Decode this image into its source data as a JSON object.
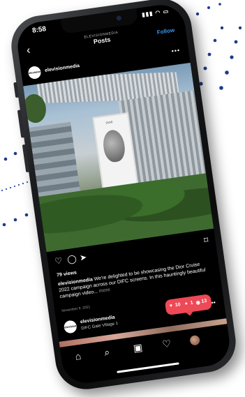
{
  "status_bar": {
    "time": "8:58",
    "icons": "▮▮▮ ◠ ▭"
  },
  "nav": {
    "back_icon": "‹",
    "subtitle": "ELEVISIONMEDIA",
    "title": "Posts",
    "follow_label": "Follow"
  },
  "post": {
    "avatar_text": "elevision",
    "username": "elevisionmedia",
    "more_icon": "•••",
    "views": "79 views",
    "caption_user": "elevisionmedia",
    "caption_text": " We're delighted to be showcasing the Dior Cruise 2022 campaign across our DIFC screens. In this hauntingly beautiful campaign video...",
    "caption_more": " more",
    "date": "November 9, 2021",
    "panel_logo": "DIOR"
  },
  "post2": {
    "username": "elevisionmedia",
    "location": "DIFC Gate Village 1",
    "more_icon": "•••"
  },
  "actions": {
    "like_icon": "♡",
    "comment_icon": "◯",
    "share_icon": "➤",
    "save_icon": "⌑"
  },
  "notification": {
    "likes": "10",
    "followers": "1",
    "comments": "13"
  },
  "bottom_nav": {
    "home_icon": "⌂",
    "search_icon": "⌕",
    "reels_icon": "▣",
    "activity_icon": "♡"
  },
  "colors": {
    "accent": "#3897f0",
    "notification": "#ed4956",
    "dots": "#1f3a8a"
  }
}
